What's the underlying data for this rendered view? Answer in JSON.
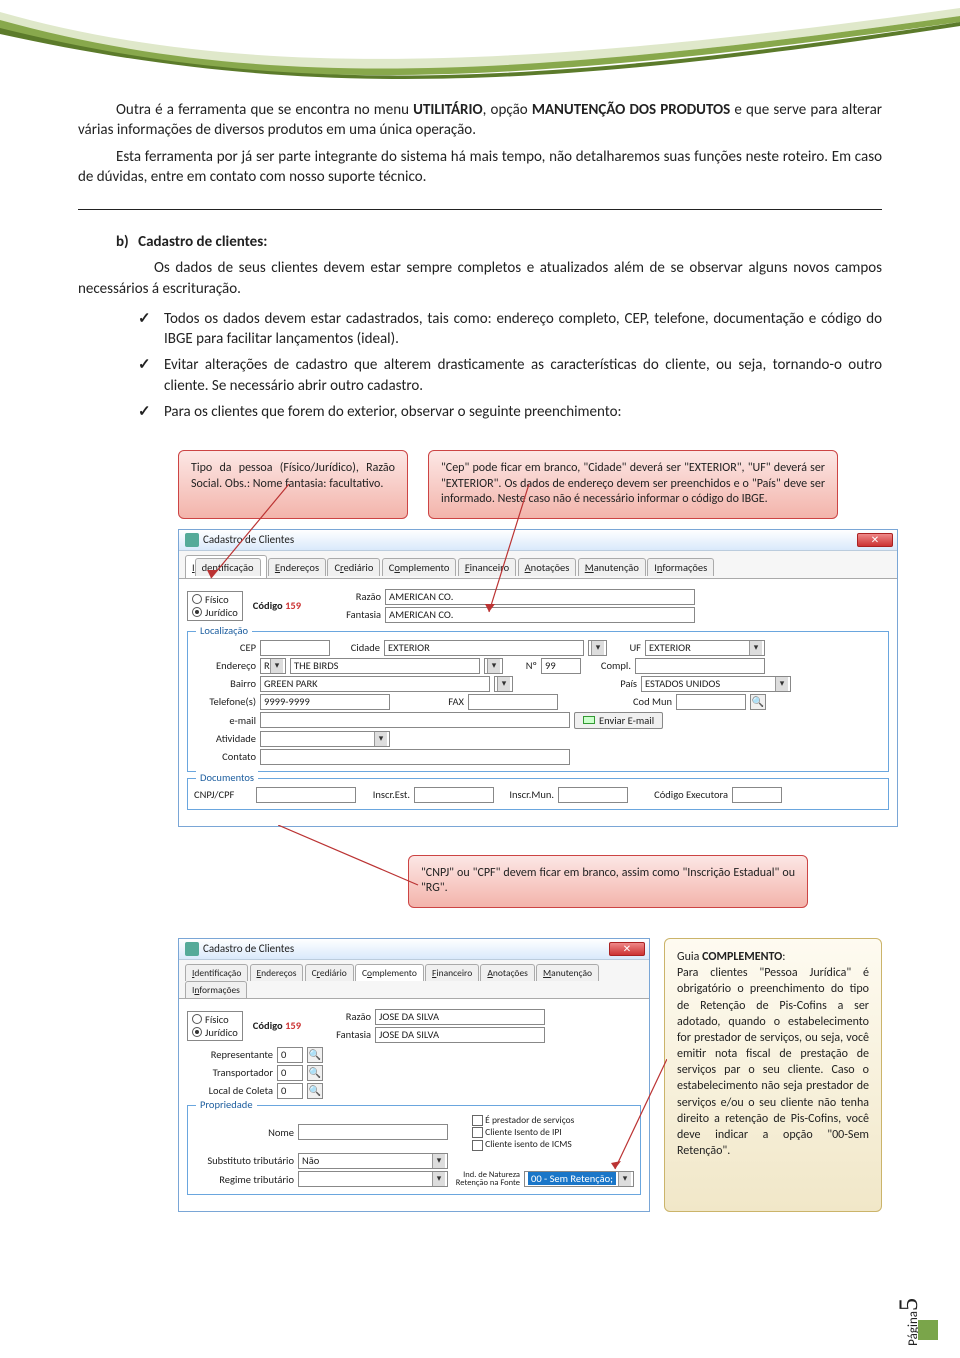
{
  "swoosh": {
    "c1": "#dee6c8",
    "c2": "#86a646",
    "c3": "#5b7a2a"
  },
  "body": {
    "p1a": "Outra é a ferramenta que se encontra no menu ",
    "p1b": "UTILITÁRIO",
    "p1c": ", opção ",
    "p1d": "MANUTENÇÃO DOS PRODUTOS",
    "p1e": " e que serve para alterar várias informações de diversos produtos em uma única operação.",
    "p2": "Esta ferramenta por já ser parte integrante do sistema há mais tempo, não detalharemos suas funções neste roteiro. Em caso de dúvidas, entre em contato com nosso suporte técnico.",
    "b_label": "b)",
    "b_title": "Cadastro de clientes:",
    "b_text": "Os dados de seus clientes devem estar sempre completos e atualizados além de se observar alguns novos campos necessários á escrituração.",
    "bul1": "Todos os dados devem estar cadastrados, tais como: endereço completo, CEP, telefone, documentação e código do IBGE para facilitar lançamentos (ideal).",
    "bul2": "Evitar alterações de cadastro que alterem drasticamente as características do cliente, ou seja, tornando-o outro cliente. Se necessário abrir outro cadastro.",
    "bul3": "Para os clientes que forem do exterior, observar o seguinte preenchimento:"
  },
  "callouts": {
    "c1": "Tipo da pessoa (Físico/Jurídico), Razão Social. Obs.: Nome fantasia: facultativo.",
    "c2": "\"Cep\" pode ficar em branco, \"Cidade\" deverá ser \"EXTERIOR\", \"UF\" deverá ser \"EXTERIOR\". Os dados de endereço devem ser preenchidos e o \"País\" deve ser informado. Neste caso não é necessário informar o código do IBGE.",
    "c3": "\"CNPJ\" ou \"CPF\" devem ficar em branco, assim como \"Inscrição Estadual\" ou \"RG\"."
  },
  "form1": {
    "title": "Cadastro de Clientes",
    "tabs": [
      "Identificação",
      "Endereços",
      "Crediário",
      "Complemento",
      "Financeiro",
      "Anotações",
      "Manutenção",
      "Informações"
    ],
    "active_tab": 0,
    "codigo_label": "Código",
    "codigo": "159",
    "radio_fisico": "Físico",
    "radio_juridico": "Jurídico",
    "razao_lbl": "Razão",
    "razao": "AMERICAN CO.",
    "fantasia_lbl": "Fantasia",
    "fantasia": "AMERICAN CO.",
    "loc_legend": "Localização",
    "cep_lbl": "CEP",
    "cep": "",
    "cidade_lbl": "Cidade",
    "cidade": "EXTERIOR",
    "uf_lbl": "UF",
    "uf": "EXTERIOR",
    "endereco_lbl": "Endereço",
    "endereco_tipo": "R",
    "endereco": "THE BIRDS",
    "num_lbl": "Nº",
    "num": "99",
    "compl_lbl": "Compl.",
    "compl": "",
    "bairro_lbl": "Bairro",
    "bairro": "GREEN PARK",
    "pais_lbl": "País",
    "pais": "ESTADOS UNIDOS",
    "tel_lbl": "Telefone(s)",
    "tel": "9999-9999",
    "fax_lbl": "FAX",
    "fax": "",
    "codmun_lbl": "Cod Mun",
    "codmun": "",
    "email_lbl": "e-mail",
    "email": "",
    "enviar_email": "Enviar E-mail",
    "atividade_lbl": "Atividade",
    "atividade": "",
    "contato_lbl": "Contato",
    "contato": "",
    "doc_legend": "Documentos",
    "cnpj_lbl": "CNPJ/CPF",
    "cnpj": "",
    "inscest_lbl": "Inscr.Est.",
    "inscest": "",
    "inscmun_lbl": "Inscr.Mun.",
    "inscmun": "",
    "codexec_lbl": "Código Executora",
    "codexec": ""
  },
  "form2": {
    "title": "Cadastro de Clientes",
    "tabs": [
      "Identificação",
      "Endereços",
      "Crediário",
      "Complemento",
      "Financeiro",
      "Anotações",
      "Manutenção",
      "Informações"
    ],
    "active_tab": 3,
    "codigo_label": "Código",
    "codigo": "159",
    "radio_fisico": "Físico",
    "radio_juridico": "Jurídico",
    "razao_lbl": "Razão",
    "razao": "JOSE DA SILVA",
    "fantasia_lbl": "Fantasia",
    "fantasia": "JOSE DA SILVA",
    "rep_lbl": "Representante",
    "rep": "0",
    "trans_lbl": "Transportador",
    "trans": "0",
    "coleta_lbl": "Local de Coleta",
    "coleta": "0",
    "prop_legend": "Propriedade",
    "nome_lbl": "Nome",
    "nome": "",
    "subst_lbl": "Substituto tributário",
    "subst": "Não",
    "regime_lbl": "Regime tributário",
    "regime": "",
    "chk1": "É prestador de serviços",
    "chk2": "Cliente Isento de IPI",
    "chk3": "Cliente isento de ICMS",
    "ind_lbl": "Ind. de Natureza Retenção na Fonte",
    "ind_val": "00 - Sem Retenção;"
  },
  "sidenote": {
    "title": "Guia ",
    "title_bold": "COMPLEMENTO",
    "colon": ":",
    "text": "Para clientes \"Pessoa Jurídica\" é obrigatório o preenchimento do tipo de Retenção de Pis-Cofins a ser adotado, quando o estabelecimento for prestador de serviços, ou seja, você emitir nota fiscal de prestação de serviços par o seu cliente. Caso o estabelecimento não seja prestador de serviços e/ou o seu cliente não tenha direito a retenção de Pis-Cofins, você deve indicar a opção \"00-Sem Retenção\"."
  },
  "page": {
    "label": "Página",
    "num": "5"
  }
}
